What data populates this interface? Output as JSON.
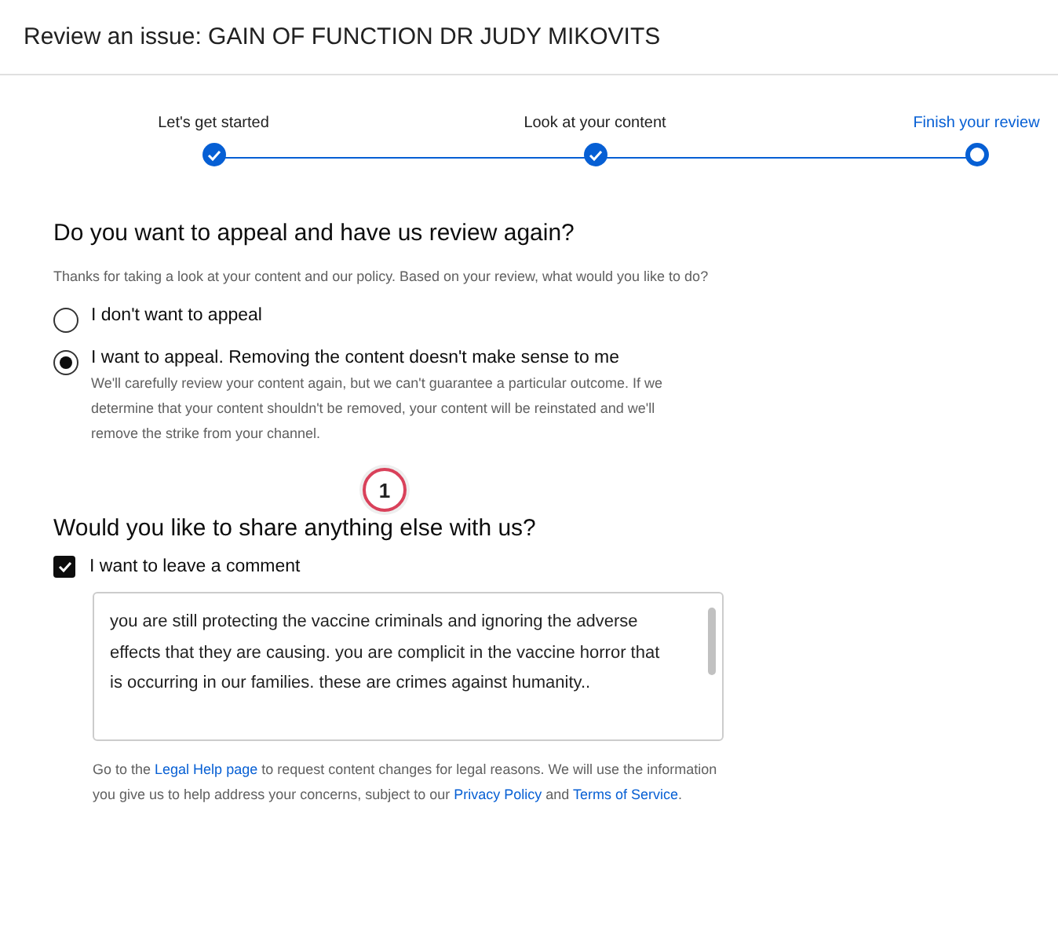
{
  "window": {
    "title": "Review an issue: GAIN OF FUNCTION DR JUDY MIKOVITS"
  },
  "steps": [
    {
      "label": "Let's get started",
      "done": true,
      "selected": false
    },
    {
      "label": "Look at your content",
      "done": true,
      "selected": false
    },
    {
      "label": "Finish your review",
      "done": false,
      "selected": true
    }
  ],
  "appeal": {
    "heading": "Do you want to appeal and have us review again?",
    "intro": "Thanks for taking a look at your content and our policy. Based on your review, what would you like to do?",
    "options": [
      {
        "label": "I don't want to appeal",
        "selected": false
      },
      {
        "label": "I want to appeal. Removing the content doesn't make sense to me",
        "selected": true,
        "description": "We'll carefully review your content again, but we can't guarantee a particular outcome. If we determine that your content shouldn't be removed, your content will be reinstated and we'll remove the strike from your channel."
      }
    ]
  },
  "marker": "1",
  "share": {
    "heading": "Would you like to share anything else with us?",
    "checkbox": {
      "label": "I want to leave a comment",
      "checked": true
    },
    "comment": "you are still protecting the vaccine criminals and ignoring the adverse effects that they are causing. you are complicit in the vaccine horror that is occurring in our families. these are crimes against humanity..",
    "footer": [
      {
        "kind": "text",
        "text": "Go to the "
      },
      {
        "kind": "link",
        "text": "Legal Help page"
      },
      {
        "kind": "text",
        "text": " to request content changes for legal reasons. We will use the information you give us to help address your concerns, subject to our "
      },
      {
        "kind": "link",
        "text": "Privacy Policy"
      },
      {
        "kind": "text",
        "text": " and "
      },
      {
        "kind": "link",
        "text": "Terms of Service"
      },
      {
        "kind": "text",
        "text": "."
      }
    ]
  }
}
